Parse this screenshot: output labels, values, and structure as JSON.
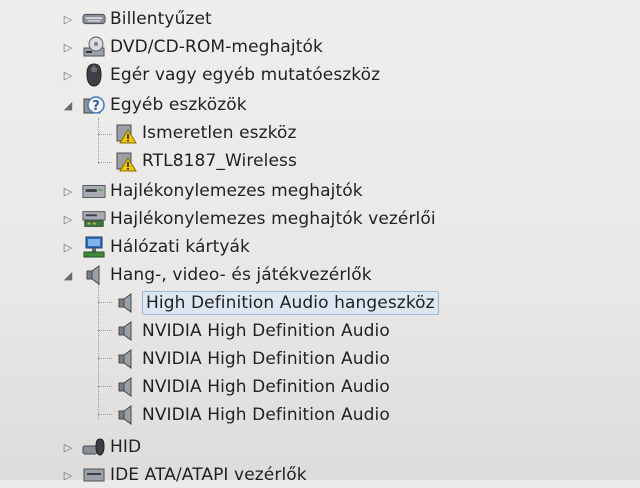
{
  "device_manager": {
    "categories": [
      {
        "label": "Billentyűzet",
        "icon": "keyboard-icon",
        "expanded": false
      },
      {
        "label": "DVD/CD-ROM-meghajtók",
        "icon": "optical-drive-icon",
        "expanded": false
      },
      {
        "label": "Egér vagy egyéb mutatóeszköz",
        "icon": "mouse-icon",
        "expanded": false
      },
      {
        "label": "Egyéb eszközök",
        "icon": "unknown-device-icon",
        "expanded": true,
        "children": [
          {
            "label": "Ismeretlen eszköz",
            "icon": "warning-device-icon"
          },
          {
            "label": "RTL8187_Wireless",
            "icon": "warning-device-icon"
          }
        ]
      },
      {
        "label": "Hajlékonylemezes meghajtók",
        "icon": "floppy-drive-icon",
        "expanded": false
      },
      {
        "label": "Hajlékonylemezes meghajtók vezérlői",
        "icon": "floppy-controller-icon",
        "expanded": false
      },
      {
        "label": "Hálózati kártyák",
        "icon": "network-adapter-icon",
        "expanded": false
      },
      {
        "label": "Hang-, video- és játékvezérlők",
        "icon": "speaker-icon",
        "expanded": true,
        "children": [
          {
            "label": "High Definition Audio hangeszköz",
            "icon": "speaker-icon",
            "selected": true
          },
          {
            "label": "NVIDIA High Definition Audio",
            "icon": "speaker-icon"
          },
          {
            "label": "NVIDIA High Definition Audio",
            "icon": "speaker-icon"
          },
          {
            "label": "NVIDIA High Definition Audio",
            "icon": "speaker-icon"
          },
          {
            "label": "NVIDIA High Definition Audio",
            "icon": "speaker-icon"
          }
        ]
      },
      {
        "label": "HID",
        "icon": "hid-icon",
        "expanded": false
      },
      {
        "label": "IDE ATA/ATAPI vezérlők",
        "icon": "ide-controller-icon",
        "expanded": false
      }
    ]
  }
}
